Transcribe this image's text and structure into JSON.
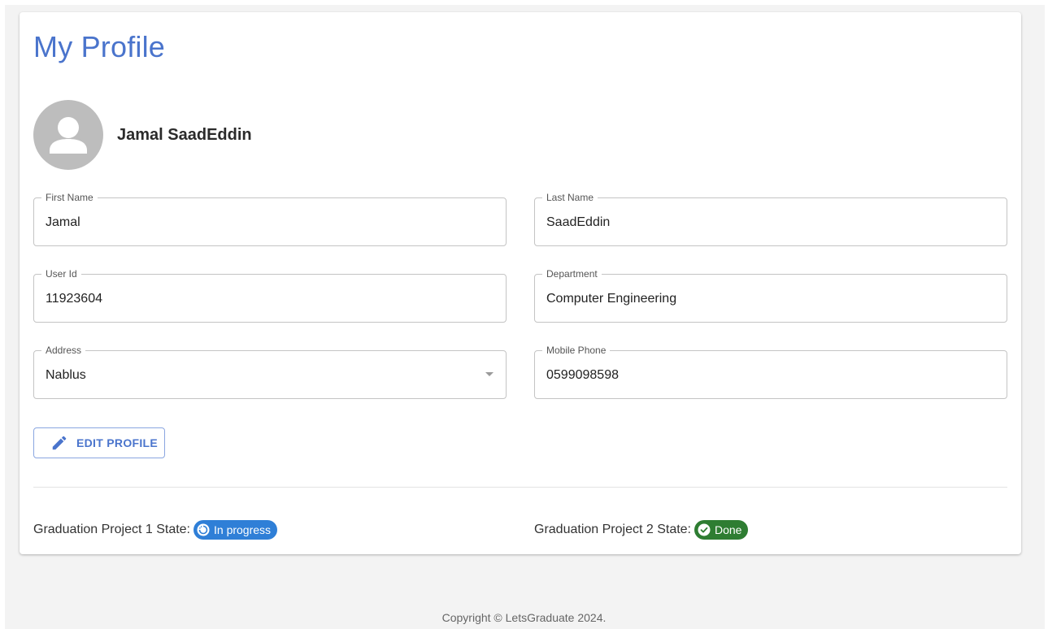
{
  "profile": {
    "title": "My Profile",
    "full_name": "Jamal SaadEddin",
    "fields": {
      "first_name": {
        "label": "First Name",
        "value": "Jamal"
      },
      "last_name": {
        "label": "Last Name",
        "value": "SaadEddin"
      },
      "user_id": {
        "label": "User Id",
        "value": "11923604"
      },
      "department": {
        "label": "Department",
        "value": "Computer Engineering"
      },
      "address": {
        "label": "Address",
        "value": "Nablus"
      },
      "mobile_phone": {
        "label": "Mobile Phone",
        "value": "0599098598"
      }
    },
    "edit_button_label": "EDIT PROFILE",
    "states": {
      "gp1": {
        "label": "Graduation Project 1 State:",
        "status": "In progress",
        "icon": "progress-icon",
        "color": "#2f7fd7"
      },
      "gp2": {
        "label": "Graduation Project 2 State:",
        "status": "Done",
        "icon": "check-circle-icon",
        "color": "#2e7d32"
      }
    }
  },
  "colors": {
    "accent": "#4a74cc",
    "background": "#f3f3f3"
  },
  "footer": {
    "copyright": "Copyright © LetsGraduate 2024."
  }
}
